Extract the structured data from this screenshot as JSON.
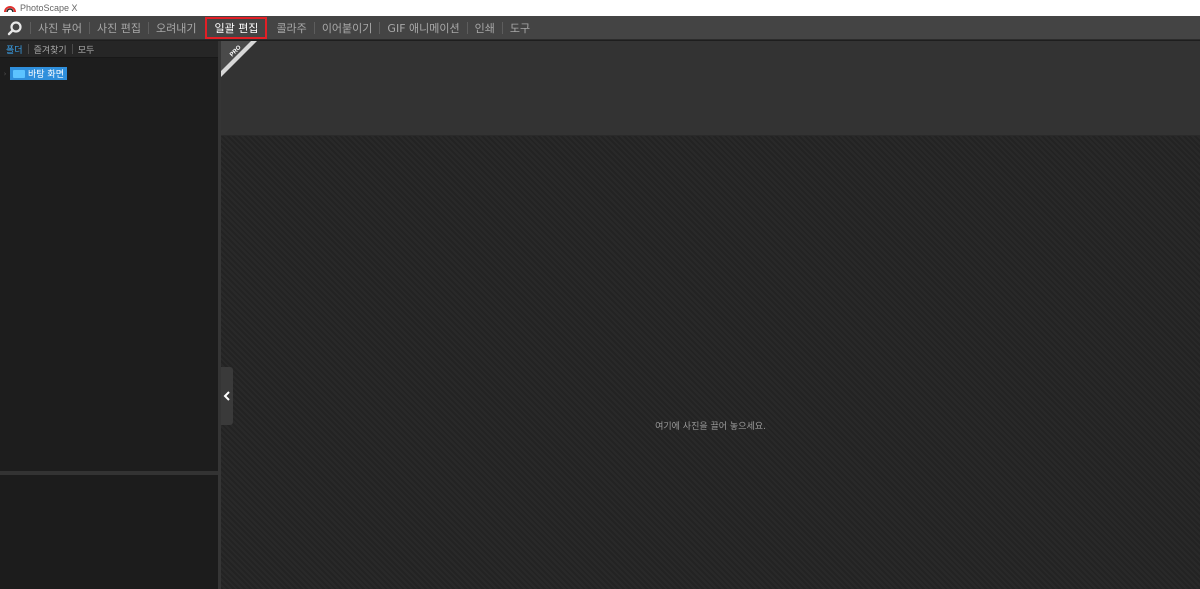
{
  "window": {
    "title": "PhotoScape X"
  },
  "menu": {
    "items": [
      {
        "label": "사진 뷰어"
      },
      {
        "label": "사진 편집"
      },
      {
        "label": "오려내기"
      },
      {
        "label": "일괄 편집",
        "active": true
      },
      {
        "label": "콜라주"
      },
      {
        "label": "이어붙이기"
      },
      {
        "label": "GIF 애니메이션"
      },
      {
        "label": "인쇄"
      },
      {
        "label": "도구"
      }
    ]
  },
  "sidebar": {
    "tabs": [
      {
        "label": "폴더",
        "active": true
      },
      {
        "label": "즐겨찾기"
      },
      {
        "label": "모두"
      }
    ],
    "tree": {
      "root_label": "바탕 화면"
    }
  },
  "badge": {
    "label": "PRO"
  },
  "main": {
    "drop_hint": "여기에 사진을 끌어 놓으세요."
  },
  "colors": {
    "accent": "#2f8fdc",
    "active_outline": "#e21f26",
    "menubar": "#444444"
  },
  "icons": {
    "home": "search-icon",
    "collapse": "chevron-left-icon",
    "folder": "folder-icon"
  }
}
